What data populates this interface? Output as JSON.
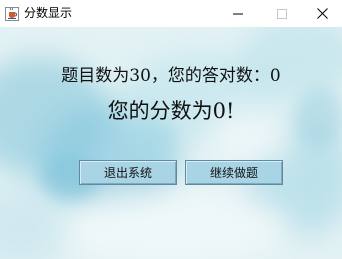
{
  "window": {
    "title": "分数显示",
    "icons": {
      "app": "java-cup-icon",
      "minimize": "minimize-icon",
      "maximize": "maximize-icon",
      "close": "close-icon"
    }
  },
  "main": {
    "summary_label": "题目数为",
    "question_count": "30",
    "correct_label": "，您的答对数：",
    "correct_count": "0",
    "score_prefix": "您的分数为",
    "score_value": "0",
    "score_suffix": "!"
  },
  "buttons": {
    "exit_label": "退出系统",
    "continue_label": "继续做题"
  },
  "colors": {
    "button_bg": "#a9d4e5",
    "button_border": "#5f8aa0",
    "background_wash": "#dff0f3"
  }
}
